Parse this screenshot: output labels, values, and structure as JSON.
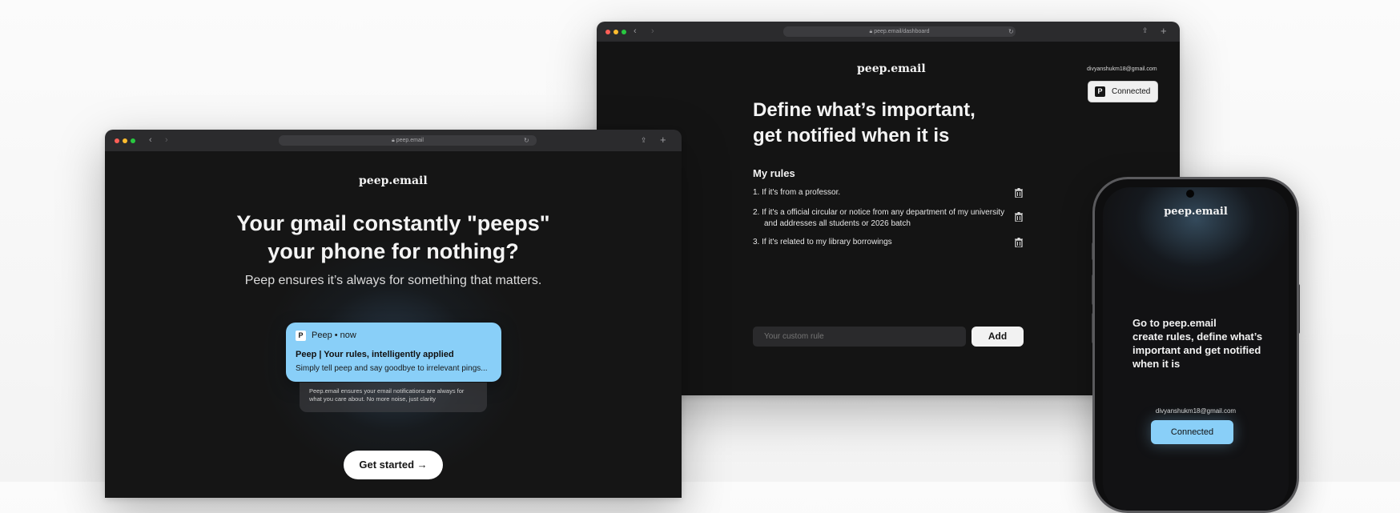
{
  "dashboard": {
    "url": "peep.email/dashboard",
    "logo": "peep.email",
    "user_email": "divyanshukm18@gmail.com",
    "connected_label": "Connected",
    "connected_icon": "P",
    "headline_line1": "Define what’s important,",
    "headline_line2": "get notified when it is",
    "rules_title": "My rules",
    "rules": [
      {
        "num": "1.",
        "text": "If it's from a professor.",
        "text2": ""
      },
      {
        "num": "2.",
        "text": "If it's a official circular or notice from any department of my university",
        "text2": "and addresses all students or 2026 batch"
      },
      {
        "num": "3.",
        "text": "If it's related to my library borrowings",
        "text2": ""
      }
    ],
    "input_placeholder": "Your custom rule",
    "add_label": "Add"
  },
  "landing": {
    "url": "peep.email",
    "logo": "peep.email",
    "headline_line1": "Your gmail constantly \"peeps\"",
    "headline_line2": "your phone for nothing?",
    "subheadline": "Peep ensures it’s always for something that matters.",
    "notification": {
      "app_icon": "P",
      "app": "Peep • now",
      "title": "Peep | Your rules, intelligently applied",
      "body": "Simply tell peep and say goodbye to irrelevant pings...",
      "sub_line1": "Peep.email ensures your email notifications are always for",
      "sub_line2": "what you care about. No more noise, just clarity"
    },
    "cta": "Get started →"
  },
  "phone": {
    "logo": "peep.email",
    "message_line1": "Go to peep.email",
    "message_line2": "create rules, define what’s",
    "message_line3": "important and get notified",
    "message_line4": "when it is",
    "user_email": "divyanshukm18@gmail.com",
    "connected_label": "Connected"
  },
  "colors": {
    "accent": "#89cff8",
    "page_bg": "#f5f5f5",
    "app_bg": "#151515"
  },
  "icons": [
    "lock-icon",
    "back-icon",
    "forward-icon",
    "reload-icon",
    "share-icon",
    "new-tab-icon",
    "trash-icon"
  ]
}
